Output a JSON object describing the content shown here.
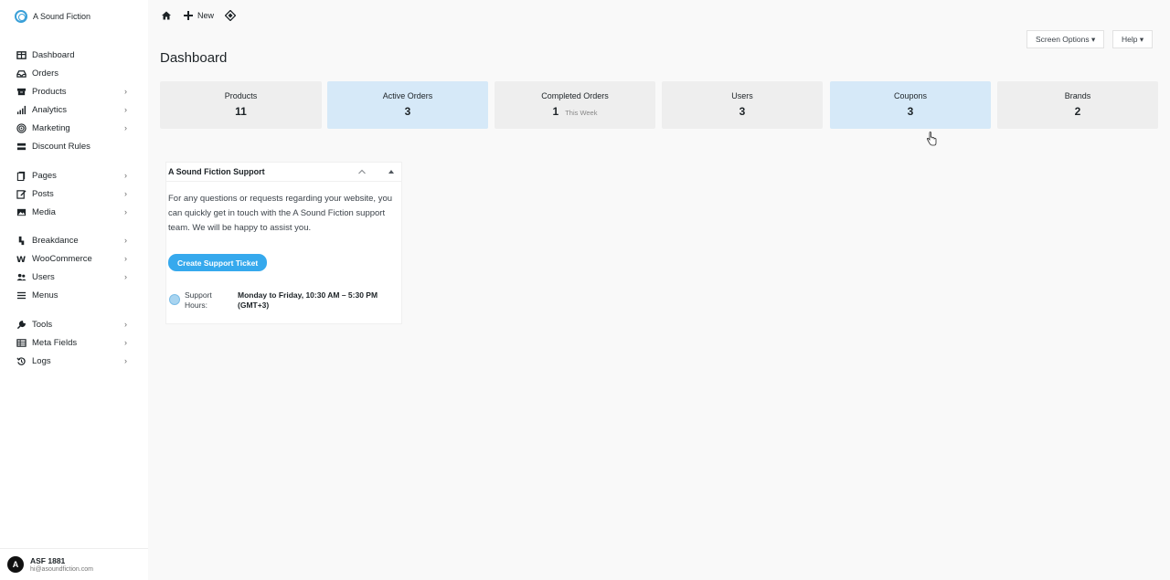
{
  "brand": {
    "name": "A Sound Fiction",
    "logo_icon": "circle-logo-icon",
    "accent": "#3aa0d8"
  },
  "sidebar": {
    "items": [
      {
        "label": "Dashboard",
        "icon": "dashboard-icon",
        "has_submenu": false
      },
      {
        "label": "Orders",
        "icon": "inbox-icon",
        "has_submenu": false
      },
      {
        "label": "Products",
        "icon": "box-icon",
        "has_submenu": true
      },
      {
        "label": "Analytics",
        "icon": "bar-chart-icon",
        "has_submenu": true
      },
      {
        "label": "Marketing",
        "icon": "target-icon",
        "has_submenu": true
      },
      {
        "label": "Discount Rules",
        "icon": "tag-icon",
        "has_submenu": false
      },
      {
        "label": "Pages",
        "icon": "pages-icon",
        "has_submenu": true
      },
      {
        "label": "Posts",
        "icon": "edit-icon",
        "has_submenu": true
      },
      {
        "label": "Media",
        "icon": "image-icon",
        "has_submenu": true
      },
      {
        "label": "Breakdance",
        "icon": "breakdance-icon",
        "has_submenu": true
      },
      {
        "label": "WooCommerce",
        "icon": "woo-icon",
        "has_submenu": true
      },
      {
        "label": "Users",
        "icon": "users-icon",
        "has_submenu": true
      },
      {
        "label": "Menus",
        "icon": "menu-icon",
        "has_submenu": false
      },
      {
        "label": "Tools",
        "icon": "wrench-icon",
        "has_submenu": true
      },
      {
        "label": "Meta Fields",
        "icon": "table-icon",
        "has_submenu": true
      },
      {
        "label": "Logs",
        "icon": "history-icon",
        "has_submenu": true
      }
    ]
  },
  "user": {
    "initial": "A",
    "name": "ASF 1881",
    "email": "hi@asoundfiction.com"
  },
  "topbar": {
    "new_label": "New"
  },
  "screen_options": {
    "label": "Screen Options ▾",
    "help_label": "Help ▾"
  },
  "page": {
    "title": "Dashboard"
  },
  "stats": [
    {
      "title": "Products",
      "value": "11",
      "sub": "",
      "highlight": false
    },
    {
      "title": "Active Orders",
      "value": "3",
      "sub": "",
      "highlight": true
    },
    {
      "title": "Completed Orders",
      "value": "1",
      "sub": "This Week",
      "highlight": false
    },
    {
      "title": "Users",
      "value": "3",
      "sub": "",
      "highlight": false
    },
    {
      "title": "Coupons",
      "value": "3",
      "sub": "",
      "highlight": true
    },
    {
      "title": "Brands",
      "value": "2",
      "sub": "",
      "highlight": false
    }
  ],
  "support_widget": {
    "title": "A Sound Fiction Support",
    "body": "For any questions or requests regarding your website, you can quickly get in touch with the A Sound Fiction support team. We will be happy to assist you.",
    "button_label": "Create Support Ticket",
    "button_color": "#36a9ed",
    "hours_label": "Support Hours:",
    "hours_value": "Monday to Friday, 10:30 AM – 5:30 PM (GMT+3)"
  },
  "colors": {
    "stat_default": "#eeeeee",
    "stat_highlight": "#d6e9f8"
  }
}
